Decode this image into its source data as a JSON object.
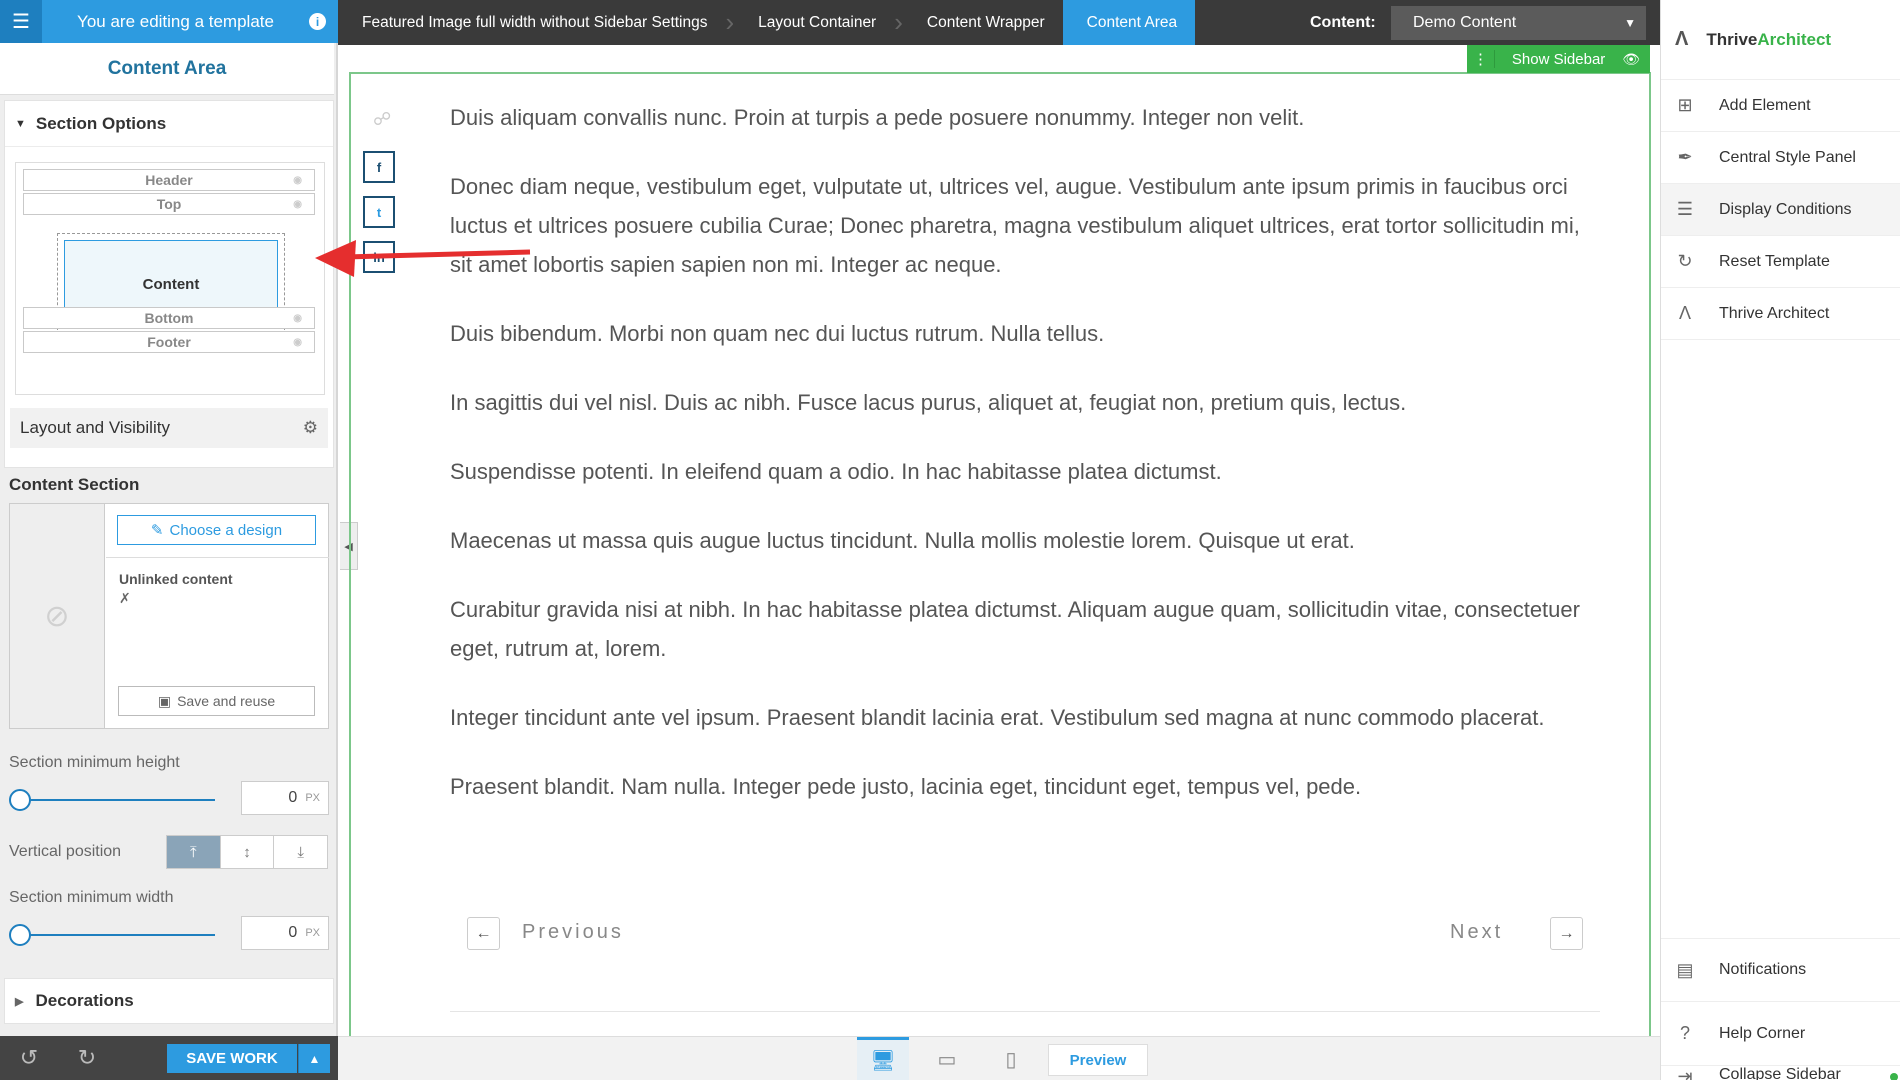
{
  "template_bar": {
    "text": "You are editing a template",
    "info_icon": "info-icon"
  },
  "left_panel": {
    "title": "Content Area",
    "section_options": {
      "label": "Section Options",
      "structure": {
        "header": "Header",
        "top": "Top",
        "content": "Content",
        "bottom": "Bottom",
        "footer": "Footer"
      },
      "layout_visibility": "Layout and Visibility"
    },
    "content_section": {
      "title": "Content Section",
      "choose_design": "Choose a design",
      "unlinked": "Unlinked content",
      "save_reuse": "Save and reuse"
    },
    "min_height": {
      "label": "Section minimum height",
      "value": "0",
      "unit": "PX"
    },
    "vertical_position": {
      "label": "Vertical position",
      "selected": "top"
    },
    "min_width": {
      "label": "Section minimum width",
      "value": "0",
      "unit": "PX"
    },
    "decorations": "Decorations",
    "save_work": "SAVE WORK"
  },
  "breadcrumbs": [
    "Featured Image full width without Sidebar Settings",
    "Layout Container",
    "Content Wrapper",
    "Content Area"
  ],
  "content_selector": {
    "label": "Content:",
    "value": "Demo Content"
  },
  "show_sidebar": "Show Sidebar",
  "article": {
    "paragraphs": [
      "Duis aliquam convallis nunc. Proin at turpis a pede posuere nonummy. Integer non velit.",
      "Donec diam neque, vestibulum eget, vulputate ut, ultrices vel, augue. Vestibulum ante ipsum primis in faucibus orci luctus et ultrices posuere cubilia Curae; Donec pharetra, magna vestibulum aliquet ultrices, erat tortor sollicitudin mi, sit amet lobortis sapien sapien non mi. Integer ac neque.",
      "Duis bibendum. Morbi non quam nec dui luctus rutrum. Nulla tellus.",
      "In sagittis dui vel nisl. Duis ac nibh. Fusce lacus purus, aliquet at, feugiat non, pretium quis, lectus.",
      "Suspendisse potenti. In eleifend quam a odio. In hac habitasse platea dictumst.",
      "Maecenas ut massa quis augue luctus tincidunt. Nulla mollis molestie lorem. Quisque ut erat.",
      "Curabitur gravida nisi at nibh. In hac habitasse platea dictumst. Aliquam augue quam, sollicitudin vitae, consectetuer eget, rutrum at, lorem.",
      "Integer tincidunt ante vel ipsum. Praesent blandit lacinia erat. Vestibulum sed magna at nunc commodo placerat.",
      "Praesent blandit. Nam nulla. Integer pede justo, lacinia eget, tincidunt eget, tempus vel, pede."
    ],
    "previous": "Previous",
    "next": "Next"
  },
  "device_bar": {
    "preview": "Preview",
    "active_device": "desktop"
  },
  "right_sidebar": {
    "brand_part1": "Thrive",
    "brand_part2": "Architect",
    "items": [
      {
        "label": "Add Element",
        "icon": "plus-square-icon"
      },
      {
        "label": "Central Style Panel",
        "icon": "brush-icon"
      },
      {
        "label": "Display Conditions",
        "icon": "sliders-icon"
      },
      {
        "label": "Reset Template",
        "icon": "refresh-icon"
      },
      {
        "label": "Thrive Architect",
        "icon": "architect-icon"
      }
    ],
    "bottom_items": [
      {
        "label": "Notifications",
        "icon": "inbox-icon"
      },
      {
        "label": "Help Corner",
        "icon": "question-icon"
      },
      {
        "label": "Collapse Sidebar",
        "icon": "collapse-icon"
      }
    ]
  },
  "colors": {
    "accent": "#2d9be0",
    "green": "#39b34a",
    "annotation": "#e52e2e"
  }
}
